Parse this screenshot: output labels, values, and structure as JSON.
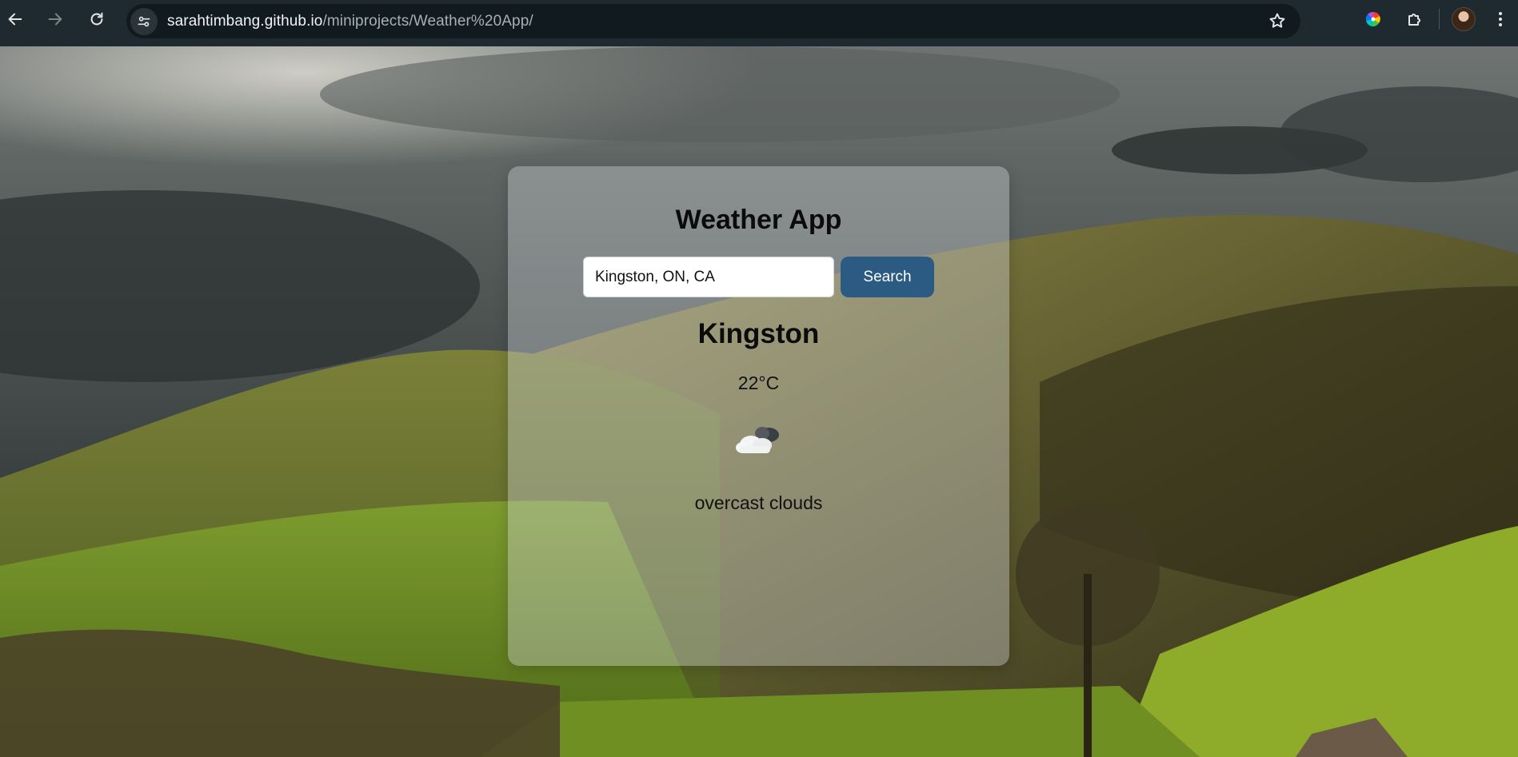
{
  "browser": {
    "url_host": "sarahtimbang.github.io",
    "url_path": "/miniprojects/Weather%20App/",
    "icons": {
      "back": "arrow-left-icon",
      "forward": "arrow-right-icon",
      "reload": "reload-icon",
      "site_info": "tune-icon",
      "bookmark": "star-icon",
      "extension_color": "color-wheel-icon",
      "extensions": "puzzle-icon",
      "menu": "kebab-menu-icon"
    }
  },
  "app": {
    "title": "Weather App",
    "search": {
      "value": "Kingston, ON, CA",
      "button_label": "Search"
    },
    "result": {
      "city": "Kingston",
      "temperature": "22°C",
      "icon": "overcast-clouds-icon",
      "description": "overcast clouds"
    }
  },
  "colors": {
    "chrome_bg": "#1f2a30",
    "omnibox_bg": "#111a1f",
    "search_button": "#2b5a83",
    "card_bg": "rgba(210,212,218,0.38)"
  }
}
